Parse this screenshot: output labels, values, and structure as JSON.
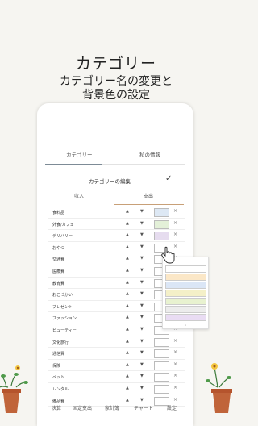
{
  "headline": {
    "title": "カテゴリー",
    "line1": "カテゴリー名の変更と",
    "line2": "背景色の設定"
  },
  "tabs": [
    "カテゴリー",
    "私の情報"
  ],
  "editor": {
    "title": "カテゴリーの編集",
    "check_icon": "check-icon"
  },
  "sub_tabs": [
    "収入",
    "支出"
  ],
  "rows": [
    {
      "name": "食料品",
      "color": "#dde8f4"
    },
    {
      "name": "外食/カフェ",
      "color": "#e3f0d8"
    },
    {
      "name": "デリバリー",
      "color": "#e6dcef"
    },
    {
      "name": "おやつ",
      "color": "#ffffff"
    },
    {
      "name": "交通費",
      "color": "#ffffff"
    },
    {
      "name": "医療費",
      "color": "#ffffff"
    },
    {
      "name": "教育費",
      "color": "#ffffff"
    },
    {
      "name": "おこづかい",
      "color": "#ffffff"
    },
    {
      "name": "プレゼント",
      "color": "#ffffff"
    },
    {
      "name": "ファッション",
      "color": "#ffffff"
    },
    {
      "name": "ビューティー",
      "color": "#ffffff"
    },
    {
      "name": "文化旅行",
      "color": "#ffffff"
    },
    {
      "name": "通信費",
      "color": "#ffffff"
    },
    {
      "name": "保険",
      "color": "#ffffff"
    },
    {
      "name": "ペット",
      "color": "#ffffff"
    },
    {
      "name": "レンタル",
      "color": "#ffffff"
    },
    {
      "name": "備品費",
      "color": "#ffffff"
    }
  ],
  "palette": {
    "colors": [
      "#ffffff",
      "#fbe7c7",
      "#dbe6f6",
      "#f4f0c8",
      "#e8f2d0",
      "#ececec",
      "#e9dcf3"
    ]
  },
  "bottom_nav": [
    "決算",
    "固定支出",
    "家計簿",
    "チャート",
    "設定"
  ]
}
